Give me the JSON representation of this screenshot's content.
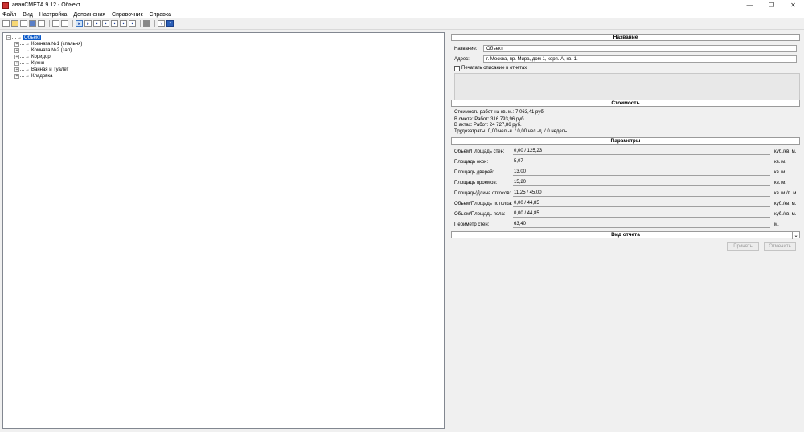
{
  "window": {
    "title": "аванСМЕТА 9.12 - Объект",
    "minimize": "—",
    "maximize": "❐",
    "close": "✕"
  },
  "menu": [
    "Файл",
    "Вид",
    "Настройка",
    "Дополнения",
    "Справочник",
    "Справка"
  ],
  "tree": {
    "root": "Объект",
    "children": [
      "Комната №1 (спальня)",
      "Комната №2 (зал)",
      "Коридор",
      "Кухня",
      "Ванная и Туалет",
      "Кладовка"
    ]
  },
  "name_section": {
    "header": "Название",
    "name_label": "Название:",
    "name_value": "Объект",
    "address_label": "Адрес:",
    "address_value": "г. Москва, пр. Мира, дом 1, корп. А, кв. 1.",
    "print_desc_label": "Печатать описание в отчетах"
  },
  "cost_section": {
    "header": "Стоимость",
    "per_sqm": "Стоимость работ на кв. м.: 7 063,41 руб.",
    "in_estimate": "В смете:  Работ: 316 793,96 руб.",
    "in_acts": "В актах:  Работ: 24 727,86 руб.",
    "labor": "Трудозатраты: 0,00 чел.-ч. / 0,00 чел.-д. / 0 недель"
  },
  "params_section": {
    "header": "Параметры",
    "rows": [
      {
        "label": "Объем/Площадь стен:",
        "value": "0,00 / 125,23",
        "unit": "куб./кв. м."
      },
      {
        "label": "Площадь окон:",
        "value": "5,07",
        "unit": "кв. м."
      },
      {
        "label": "Площадь дверей:",
        "value": "13,00",
        "unit": "кв. м."
      },
      {
        "label": "Площадь проемов:",
        "value": "15,20",
        "unit": "кв. м."
      },
      {
        "label": "Площадь/Длина откосов:",
        "value": "11,25 / 45,00",
        "unit": "кв. м./п. м."
      },
      {
        "label": "Объем/Площадь потолка:",
        "value": "0,00 / 44,85",
        "unit": "куб./кв. м."
      },
      {
        "label": "Объем/Площадь пола:",
        "value": "0,00 / 44,85",
        "unit": "куб./кв. м."
      },
      {
        "label": "Периметр стен:",
        "value": "63,40",
        "unit": "м."
      }
    ]
  },
  "report_section": {
    "header": "Вид отчета",
    "dropdown_icon": "⌄"
  },
  "actions": {
    "apply": "Принять",
    "cancel": "Отменить"
  }
}
